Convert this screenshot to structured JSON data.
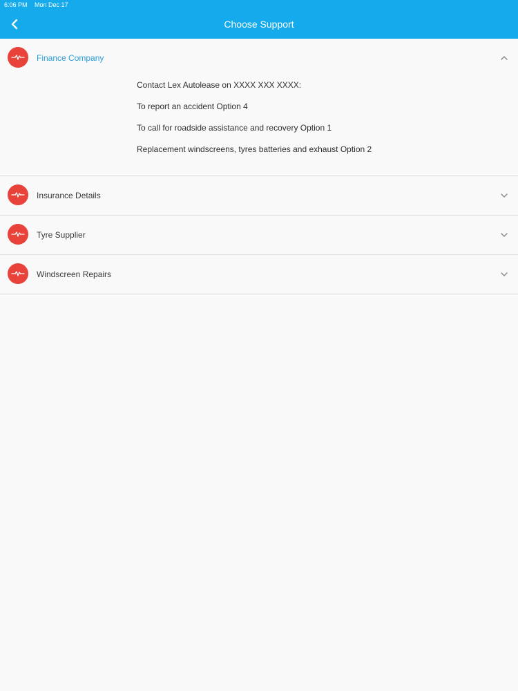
{
  "status_bar": {
    "time": "6:06 PM",
    "date": "Mon Dec 17"
  },
  "header": {
    "title": "Choose Support",
    "back_icon": "chevron-left-icon"
  },
  "colors": {
    "header_bg": "#14aaeb",
    "icon_bg": "#e9423a",
    "active_label": "#2a9fd8"
  },
  "sections": [
    {
      "label": "Finance Company",
      "icon": "heartbeat-icon",
      "expanded": true,
      "lines": [
        "Contact Lex Autolease on XXXX XXX XXXX:",
        "To report an accident Option 4",
        "To call for roadside assistance and recovery Option 1",
        "Replacement windscreens, tyres batteries and exhaust Option 2"
      ]
    },
    {
      "label": "Insurance Details",
      "icon": "heartbeat-icon",
      "expanded": false
    },
    {
      "label": "Tyre Supplier",
      "icon": "heartbeat-icon",
      "expanded": false
    },
    {
      "label": "Windscreen Repairs",
      "icon": "heartbeat-icon",
      "expanded": false
    }
  ]
}
